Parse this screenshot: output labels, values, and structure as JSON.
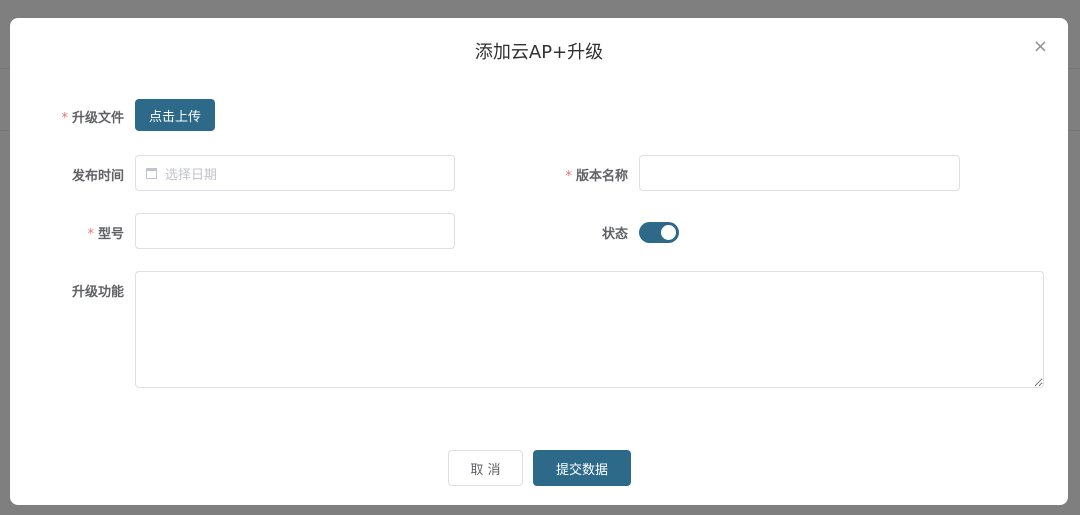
{
  "dialog": {
    "title": "添加云AP+升级",
    "close_icon": "×"
  },
  "form": {
    "upgrade_file": {
      "label": "升级文件",
      "required": "*",
      "button": "点击上传"
    },
    "release_time": {
      "label": "发布时间",
      "placeholder": "选择日期",
      "icon": "calendar-icon"
    },
    "version_name": {
      "label": "版本名称",
      "required": "*",
      "value": ""
    },
    "model": {
      "label": "型号",
      "required": "*",
      "value": ""
    },
    "status": {
      "label": "状态",
      "on": true
    },
    "features": {
      "label": "升级功能",
      "value": ""
    }
  },
  "footer": {
    "cancel": "取 消",
    "submit": "提交数据"
  },
  "colors": {
    "primary": "#2d6a8a",
    "required": "#f56c6c"
  }
}
